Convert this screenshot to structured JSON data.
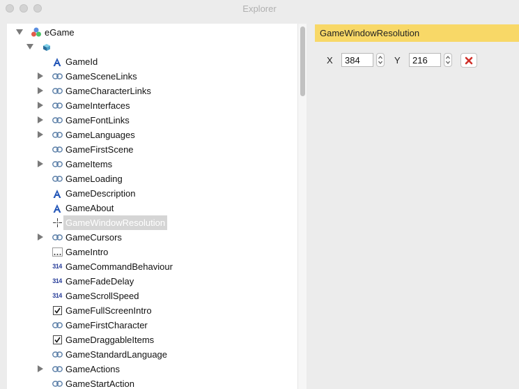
{
  "window": {
    "title": "Explorer"
  },
  "tree": {
    "root": {
      "label": "eGame"
    },
    "items": [
      {
        "label": "GameId",
        "icon": "text-type-icon",
        "expandable": false
      },
      {
        "label": "GameSceneLinks",
        "icon": "link-icon",
        "expandable": true
      },
      {
        "label": "GameCharacterLinks",
        "icon": "link-icon",
        "expandable": true
      },
      {
        "label": "GameInterfaces",
        "icon": "link-icon",
        "expandable": true
      },
      {
        "label": "GameFontLinks",
        "icon": "link-icon",
        "expandable": true
      },
      {
        "label": "GameLanguages",
        "icon": "link-icon",
        "expandable": true
      },
      {
        "label": "GameFirstScene",
        "icon": "link-icon",
        "expandable": false
      },
      {
        "label": "GameItems",
        "icon": "link-icon",
        "expandable": true
      },
      {
        "label": "GameLoading",
        "icon": "link-icon",
        "expandable": false
      },
      {
        "label": "GameDescription",
        "icon": "text-type-icon",
        "expandable": false
      },
      {
        "label": "GameAbout",
        "icon": "text-type-icon",
        "expandable": false
      },
      {
        "label": "GameWindowResolution",
        "icon": "point-icon",
        "expandable": false,
        "selected": true
      },
      {
        "label": "GameCursors",
        "icon": "link-icon",
        "expandable": true
      },
      {
        "label": "GameIntro",
        "icon": "ellipsis-icon",
        "expandable": false
      },
      {
        "label": "GameCommandBehaviour",
        "icon": "number-type-icon",
        "number_glyph": "314",
        "expandable": false
      },
      {
        "label": "GameFadeDelay",
        "icon": "number-type-icon",
        "number_glyph": "314",
        "expandable": false
      },
      {
        "label": "GameScrollSpeed",
        "icon": "number-type-icon",
        "number_glyph": "314",
        "expandable": false
      },
      {
        "label": "GameFullScreenIntro",
        "icon": "checkbox-icon",
        "checked": true,
        "expandable": false
      },
      {
        "label": "GameFirstCharacter",
        "icon": "link-icon",
        "expandable": false
      },
      {
        "label": "GameDraggableItems",
        "icon": "checkbox-icon",
        "checked": true,
        "expandable": false
      },
      {
        "label": "GameStandardLanguage",
        "icon": "link-icon",
        "expandable": false
      },
      {
        "label": "GameActions",
        "icon": "link-icon",
        "expandable": true
      },
      {
        "label": "GameStartAction",
        "icon": "link-icon",
        "expandable": false
      }
    ]
  },
  "detail": {
    "title": "GameWindowResolution",
    "x_label": "X",
    "x_value": "384",
    "y_label": "Y",
    "y_value": "216"
  },
  "colors": {
    "header_bg": "#f8d867",
    "selection_bg": "#d5d5d5",
    "delete_red": "#d0302a"
  }
}
